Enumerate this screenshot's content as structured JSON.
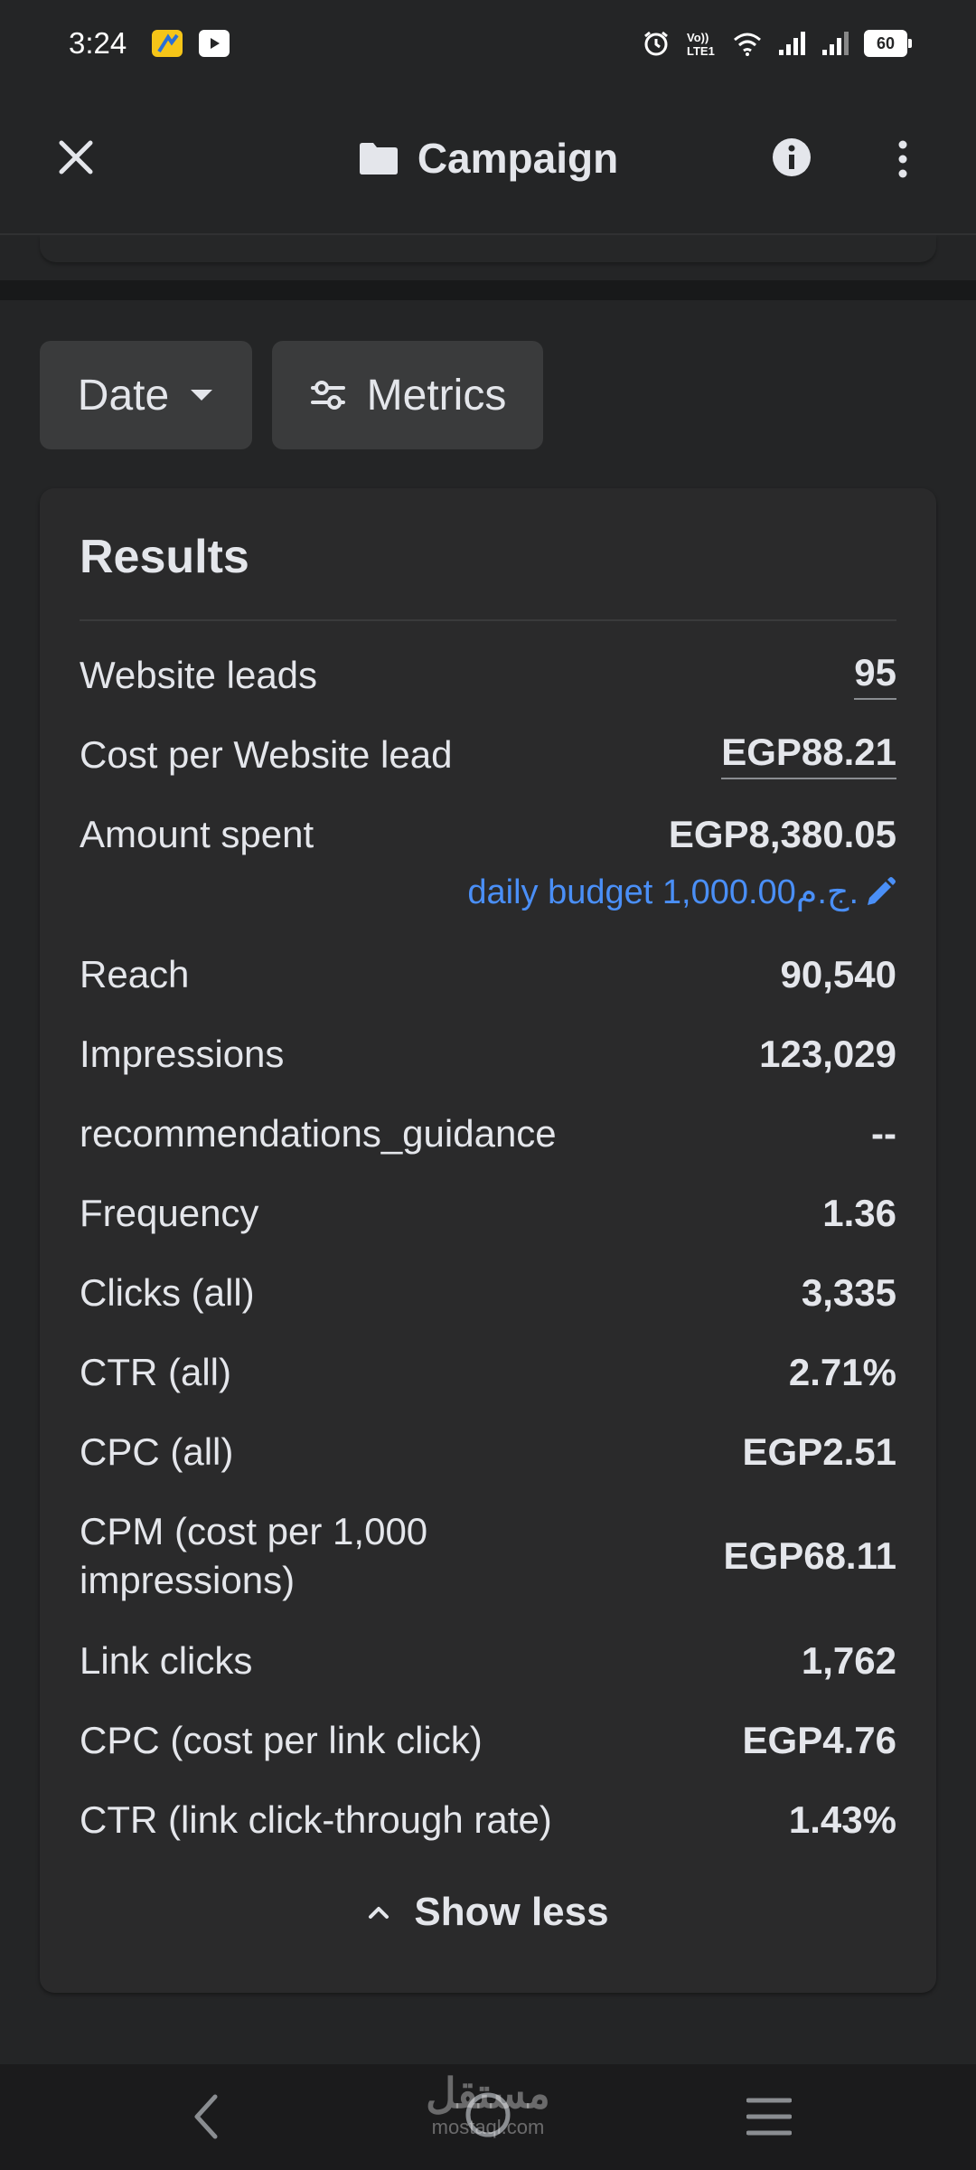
{
  "status_bar": {
    "time": "3:24",
    "battery": "60",
    "app_icons": [
      "app-icon",
      "youtube-icon"
    ],
    "indicator_icons": [
      "alarm-icon",
      "volte-icon",
      "wifi-icon",
      "signal-icon",
      "signal-icon"
    ]
  },
  "header": {
    "title": "Campaign",
    "title_icon": "folder-icon",
    "close_icon": "close-icon",
    "info_icon": "info-icon",
    "more_icon": "more-vertical-icon"
  },
  "filters": {
    "date_label": "Date",
    "metrics_label": "Metrics"
  },
  "results": {
    "title": "Results",
    "daily_budget": "daily budget 1,000.00ج.م.",
    "rows": [
      {
        "label": "Website leads",
        "value": "95"
      },
      {
        "label": "Cost per Website lead",
        "value": "EGP88.21"
      },
      {
        "label": "Amount spent",
        "value": "EGP8,380.05"
      },
      {
        "label": "Reach",
        "value": "90,540"
      },
      {
        "label": "Impressions",
        "value": "123,029"
      },
      {
        "label": "recommendations_guidance",
        "value": "--"
      },
      {
        "label": "Frequency",
        "value": "1.36"
      },
      {
        "label": "Clicks (all)",
        "value": "3,335"
      },
      {
        "label": "CTR (all)",
        "value": "2.71%"
      },
      {
        "label": "CPC (all)",
        "value": "EGP2.51"
      },
      {
        "label": "CPM (cost per 1,000 impressions)",
        "value": "EGP68.11"
      },
      {
        "label": "Link clicks",
        "value": "1,762"
      },
      {
        "label": "CPC (cost per link click)",
        "value": "EGP4.76"
      },
      {
        "label": "CTR (link click-through rate)",
        "value": "1.43%"
      }
    ],
    "show_less": "Show less"
  },
  "watermark": {
    "arabic": "مستقل",
    "latin": "mostaql.com"
  },
  "colors": {
    "background": "#242526",
    "card": "#2a2a2b",
    "button": "#3a3b3c",
    "link": "#4a8ff7",
    "text": "#e4e6eb"
  }
}
